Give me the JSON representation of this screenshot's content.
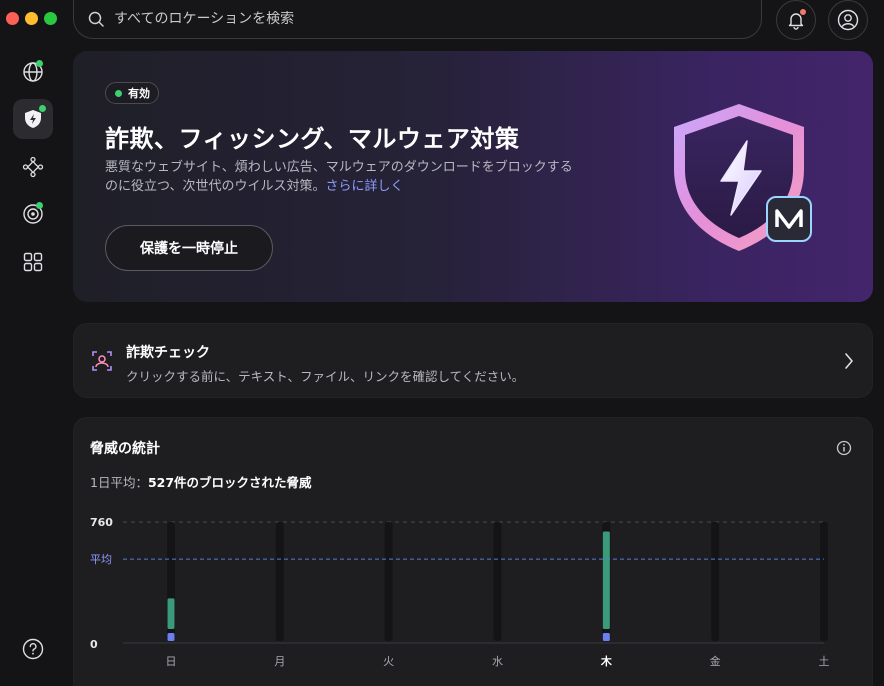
{
  "search": {
    "placeholder": "すべてのロケーションを検索"
  },
  "hero": {
    "badge": "有効",
    "title": "詐欺、フィッシング、マルウェア対策",
    "desc_line1": "悪質なウェブサイト、煩わしい広告、マルウェアのダウンロードをブロックする",
    "desc_line2": "のに役立つ、次世代のウイルス対策。",
    "more_link": "さらに詳しく",
    "pause_button": "保護を一時停止"
  },
  "scam_check": {
    "title": "詐欺チェック",
    "subtitle": "クリックする前に、テキスト、ファイル、リンクを確認してください。"
  },
  "stats": {
    "title": "脅威の統計",
    "avg_prefix": "1日平均：",
    "avg_value": "527件のブロックされた脅威"
  },
  "sidebar": {
    "items": [
      "globe-icon",
      "shield-icon",
      "nodes-icon",
      "radar-icon",
      "grid-icon",
      "help-icon"
    ]
  },
  "colors": {
    "accent_green": "#3bd16f",
    "bar_green": "#3a9a7a",
    "bar_blue": "#6b7ff0",
    "avg_line": "#5a7be0",
    "link_blue": "#8d9bff"
  },
  "chart_data": {
    "type": "bar",
    "categories": [
      "日",
      "月",
      "火",
      "水",
      "木",
      "金",
      "土"
    ],
    "highlight_category": "木",
    "series": [
      {
        "values": [
          280,
          0,
          0,
          0,
          700,
          0,
          0
        ]
      },
      {
        "values": [
          40,
          0,
          0,
          0,
          40,
          0,
          0
        ]
      }
    ],
    "ylim": [
      0,
      760
    ],
    "yticks": [
      "0",
      "760"
    ],
    "average_label": "平均",
    "average_value": 527,
    "grid": true
  }
}
